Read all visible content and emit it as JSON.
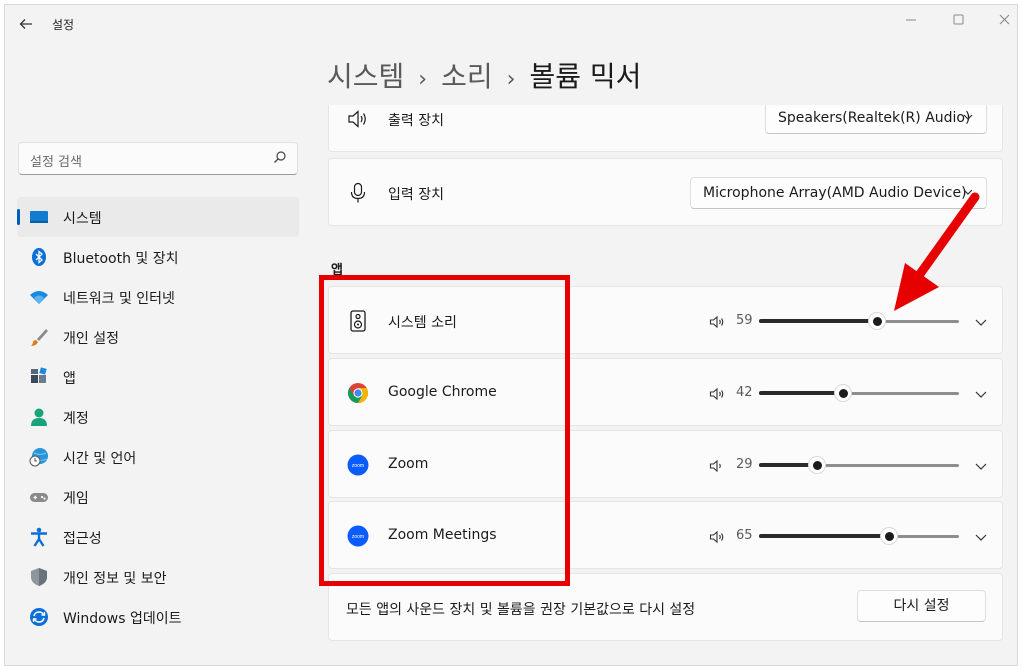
{
  "window": {
    "title": "설정",
    "back_icon": "arrow-left-icon",
    "controls": [
      "minimize-icon",
      "maximize-icon",
      "close-icon"
    ]
  },
  "search": {
    "placeholder": "설정 검색",
    "icon": "search-icon"
  },
  "nav": {
    "items": [
      {
        "label": "시스템",
        "icon": "system-monitor-icon",
        "selected": true
      },
      {
        "label": "Bluetooth 및 장치",
        "icon": "bluetooth-icon"
      },
      {
        "label": "네트워크 및 인터넷",
        "icon": "wifi-icon"
      },
      {
        "label": "개인 설정",
        "icon": "paintbrush-icon"
      },
      {
        "label": "앱",
        "icon": "apps-icon"
      },
      {
        "label": "계정",
        "icon": "account-icon"
      },
      {
        "label": "시간 및 언어",
        "icon": "globe-clock-icon"
      },
      {
        "label": "게임",
        "icon": "gamepad-icon"
      },
      {
        "label": "접근성",
        "icon": "accessibility-icon"
      },
      {
        "label": "개인 정보 및 보안",
        "icon": "shield-icon"
      },
      {
        "label": "Windows 업데이트",
        "icon": "windows-update-icon"
      }
    ]
  },
  "breadcrumb": {
    "items": [
      "시스템",
      "소리"
    ],
    "current": "볼륨 믹서",
    "separator": "›"
  },
  "devices": {
    "output": {
      "label": "출력 장치",
      "value": "Speakers(Realtek(R) Audio)",
      "icon": "speaker-volume-icon"
    },
    "input": {
      "label": "입력 장치",
      "value": "Microphone Array(AMD Audio Device)",
      "icon": "microphone-icon"
    }
  },
  "apps_section": {
    "title": "앱",
    "apps": [
      {
        "name": "시스템 소리",
        "icon": "system-sounds-icon",
        "volume": 59
      },
      {
        "name": "Google Chrome",
        "icon": "chrome-icon",
        "volume": 42
      },
      {
        "name": "Zoom",
        "icon": "zoom-icon",
        "volume": 29
      },
      {
        "name": "Zoom Meetings",
        "icon": "zoom-meetings-icon",
        "volume": 65
      }
    ]
  },
  "reset": {
    "text": "모든 앱의 사운드 장치 및 볼륨을 권장 기본값으로 다시 설정",
    "button_label": "다시 설정"
  },
  "annotation": {
    "highlight_color": "#e60000",
    "arrow_color": "#e60000"
  },
  "colors": {
    "accent": "#005fb8",
    "background": "#f3f3f3",
    "card": "#fbfbfb"
  }
}
